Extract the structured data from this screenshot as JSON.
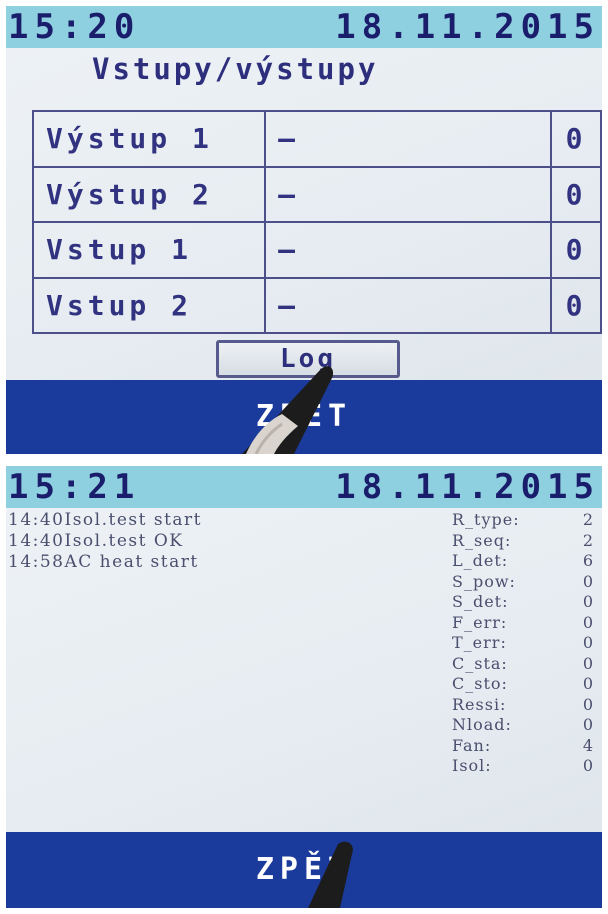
{
  "screen1": {
    "status": {
      "time": "15:20",
      "date": "18.11.2015"
    },
    "title": "Vstupy/výstupy",
    "rows": [
      {
        "name": "Výstup 1",
        "value": "–",
        "count": "0"
      },
      {
        "name": "Výstup 2",
        "value": "–",
        "count": "0"
      },
      {
        "name": "Vstup 1",
        "value": "–",
        "count": "0"
      },
      {
        "name": "Vstup 2",
        "value": "–",
        "count": "0"
      }
    ],
    "log_button": "Log",
    "back_button": "ZPĚT"
  },
  "screen2": {
    "status": {
      "time": "15:21",
      "date": "18.11.2015"
    },
    "log_entries": [
      "14:40Isol.test start",
      "14:40Isol.test OK",
      "14:58AC heat start"
    ],
    "parameters": [
      {
        "label": "R_type:",
        "value": "2"
      },
      {
        "label": "R_seq:",
        "value": "2"
      },
      {
        "label": "L_det:",
        "value": "6"
      },
      {
        "label": "S_pow:",
        "value": "0"
      },
      {
        "label": "S_det:",
        "value": "0"
      },
      {
        "label": "F_err:",
        "value": "0"
      },
      {
        "label": "T_err:",
        "value": "0"
      },
      {
        "label": "C_sta:",
        "value": "0"
      },
      {
        "label": "C_sto:",
        "value": "0"
      },
      {
        "label": "Ressi:",
        "value": "0"
      },
      {
        "label": "Nload:",
        "value": "0"
      },
      {
        "label": "Fan:",
        "value": "4"
      },
      {
        "label": "Isol:",
        "value": "0"
      }
    ],
    "back_button": "ZPĚT"
  },
  "colors": {
    "status_bar": "#8fd0e0",
    "status_text": "#1a1d6b",
    "back_bar": "#1b3b9c",
    "table_text": "#323380",
    "screen_bg": "#e6ecf1"
  },
  "icons": {
    "pointer": "stylus-icon"
  }
}
